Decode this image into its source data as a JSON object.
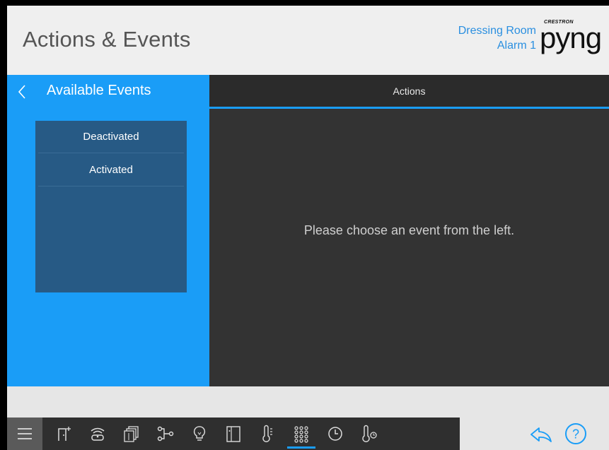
{
  "header": {
    "title": "Actions & Events",
    "room": "Dressing Room",
    "device": "Alarm 1",
    "brand_small": "CRESTRON",
    "brand_large": "pyng"
  },
  "left_panel": {
    "title": "Available Events",
    "events": [
      {
        "label": "Deactivated"
      },
      {
        "label": "Activated"
      }
    ]
  },
  "right_panel": {
    "tab_label": "Actions",
    "empty_message": "Please choose an event from the left."
  },
  "toolbar": {
    "items": [
      {
        "icon": "menu-icon"
      },
      {
        "icon": "add-room-icon"
      },
      {
        "icon": "remote-sensor-icon"
      },
      {
        "icon": "shades-icon"
      },
      {
        "icon": "scene-flow-icon"
      },
      {
        "icon": "light-bulb-icon"
      },
      {
        "icon": "door-icon"
      },
      {
        "icon": "thermostat-icon"
      },
      {
        "icon": "keypad-icon",
        "active": true
      },
      {
        "icon": "clock-icon"
      },
      {
        "icon": "temperature-sensor-icon"
      }
    ]
  },
  "colors": {
    "accent": "#1a9df7",
    "event_list_bg": "#275a85",
    "panel_dark": "#333333",
    "room_text": "#2a8fe0"
  }
}
